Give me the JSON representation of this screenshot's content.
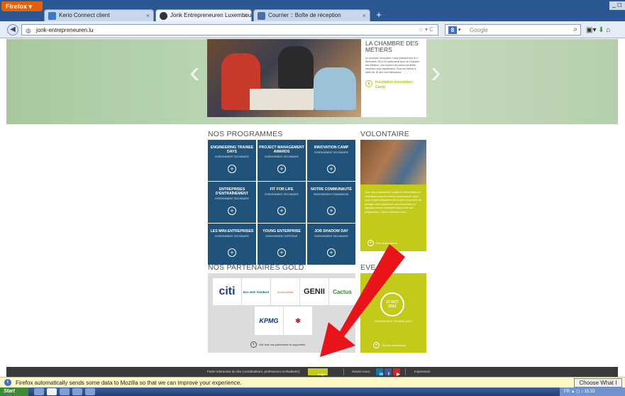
{
  "browser": {
    "menu_label": "Firefox",
    "tabs": [
      {
        "label": "Kerio Connect client",
        "color": "#3a78c9"
      },
      {
        "label": "Jonk Entrepreneuren Luxembourg asbl",
        "color": "#333333"
      },
      {
        "label": "Courrier :: Boîte de réception",
        "color": "#4a6fa5"
      }
    ],
    "url": "jonk-entrepreneuren.lu",
    "search_placeholder": "Google",
    "search_engine_icon": "google-icon"
  },
  "hero": {
    "title": "LA CHAMBRE DES MÉTIERS",
    "body": "Le prochain Innovation Camp prendra lieu le 4 décembre 2014 en partenariat avec la Chambre des Métiers. Les nombre de places est limité, inscrivez-vous rapidement. Tous les élèves à partir de 16 ans sont bienvenus.",
    "link": "Inscription Innovation Camp"
  },
  "programmes": {
    "title": "NOS PROGRAMMES",
    "tiles": [
      {
        "name": "ENGINEERING TRAINEE DAYS",
        "sub": "ENSEIGNEMENT SECONDAIRE"
      },
      {
        "name": "PROJECT MANAGEMENT AWARDS",
        "sub": "ENSEIGNEMENT SECONDAIRE"
      },
      {
        "name": "INNOVATION CAMP",
        "sub": "ENSEIGNEMENT SECONDAIRE"
      },
      {
        "name": "ENTREPRISES D'ENTRAÎNEMENT",
        "sub": "ENSEIGNEMENT SECONDAIRE"
      },
      {
        "name": "FIT FOR LIFE",
        "sub": "ENSEIGNEMENT SECONDAIRE"
      },
      {
        "name": "NOTRE COMMUNAUTÉ",
        "sub": "ENSEIGNEMENT FONDAMENTAL"
      },
      {
        "name": "LES MINI-ENTREPRISES",
        "sub": "ENSEIGNEMENT SECONDAIRE"
      },
      {
        "name": "YOUNG ENTERPRISE",
        "sub": "ENSEIGNEMENT SUPÉRIEUR"
      },
      {
        "name": "JOB SHADOW DAY",
        "sub": "ENSEIGNEMENT SECONDAIRE"
      }
    ]
  },
  "volontaire": {
    "title": "VOLONTAIRE",
    "text": "Tous nos programmes requièrent l'intervention de volontaires issus du monde professionnel. Avez-vous l'esprit entrepreneurial et avez-vous envie de partager votre expérience avec les jeunes en agissant comme volontaire dans un de nos programmes ? Alors contactez-nous !",
    "link": "Plus d'informations"
  },
  "partners": {
    "title": "NOS PARTENAIRES GOLD",
    "logos": [
      "citi",
      "BGL BNP PARIBAS",
      "ArcelorMittal",
      "GENII",
      "Cactus",
      "KPMG",
      ""
    ],
    "link": "Voir tous nos partenaires et supporters"
  },
  "events": {
    "title": "EVE",
    "date": "17 OCT 2014",
    "label": "ENGINEERING TRAINEE DAYS",
    "link": "Tous les événements"
  },
  "footer": {
    "interactive": "Partie interactive du site (coordinateurs, professeurs et étudiants):",
    "login": "Login",
    "follow": "Suivez-nous:",
    "social": [
      "in",
      "f",
      "▶"
    ],
    "impressum": "Impressum"
  },
  "notification": {
    "text": "Firefox automatically sends some data to Mozilla so that we can improve your experience.",
    "button": "Choose What I Share"
  },
  "taskbar": {
    "start": "Start",
    "tray": "FR  ▲  ◻  ♪  15:33"
  },
  "annotation": {
    "arrow_color": "#e8141a"
  }
}
